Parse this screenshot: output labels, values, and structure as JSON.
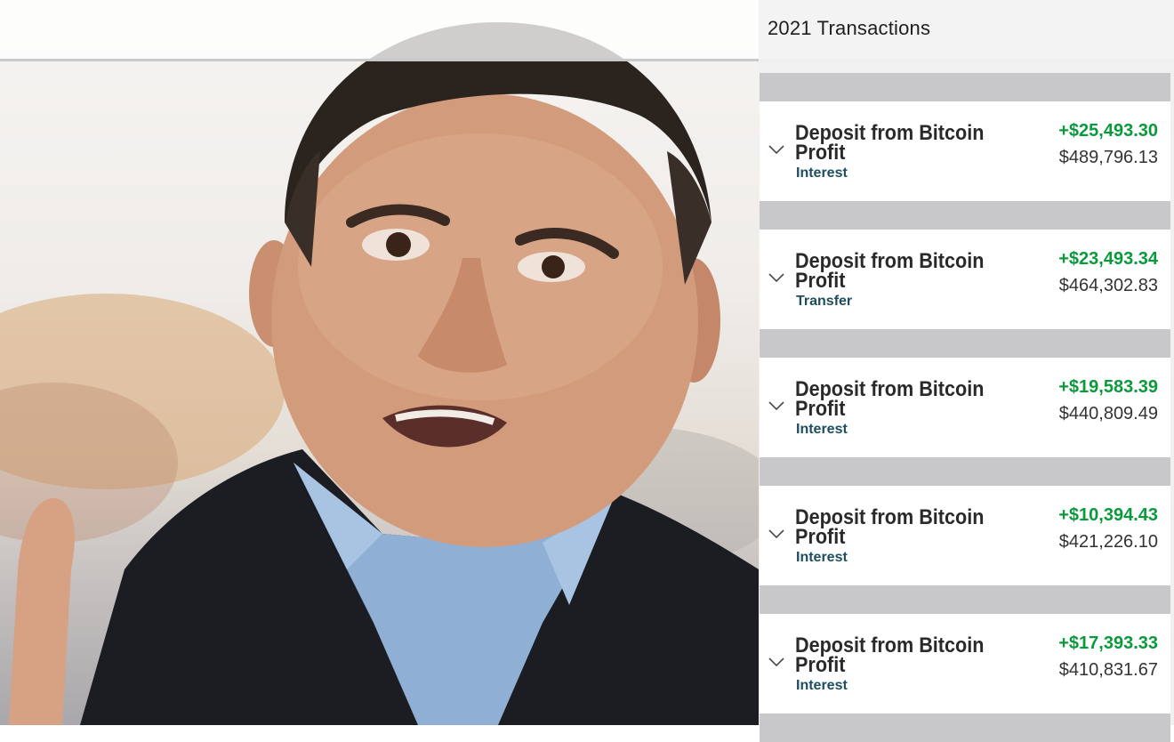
{
  "panel": {
    "title": "2021 Transactions"
  },
  "transactions": [
    {
      "title": "Deposit from Bitcoin Profit",
      "category": "Interest",
      "amount": "+$25,493.30",
      "balance": "$489,796.13"
    },
    {
      "title": "Deposit from Bitcoin Profit",
      "category": "Transfer",
      "amount": "+$23,493.34",
      "balance": "$464,302.83"
    },
    {
      "title": "Deposit from Bitcoin Profit",
      "category": "Interest",
      "amount": "+$19,583.39",
      "balance": "$440,809.49"
    },
    {
      "title": "Deposit from Bitcoin Profit",
      "category": "Interest",
      "amount": "+$10,394.43",
      "balance": "$421,226.10"
    },
    {
      "title": "Deposit from Bitcoin Profit",
      "category": "Interest",
      "amount": "+$17,393.33",
      "balance": "$410,831.67"
    }
  ],
  "icons": {
    "expand": "chevron-down-icon"
  },
  "colors": {
    "amount_positive": "#0a9a3c",
    "category_text": "#1d4e5d",
    "separator": "#c8c8ca"
  }
}
